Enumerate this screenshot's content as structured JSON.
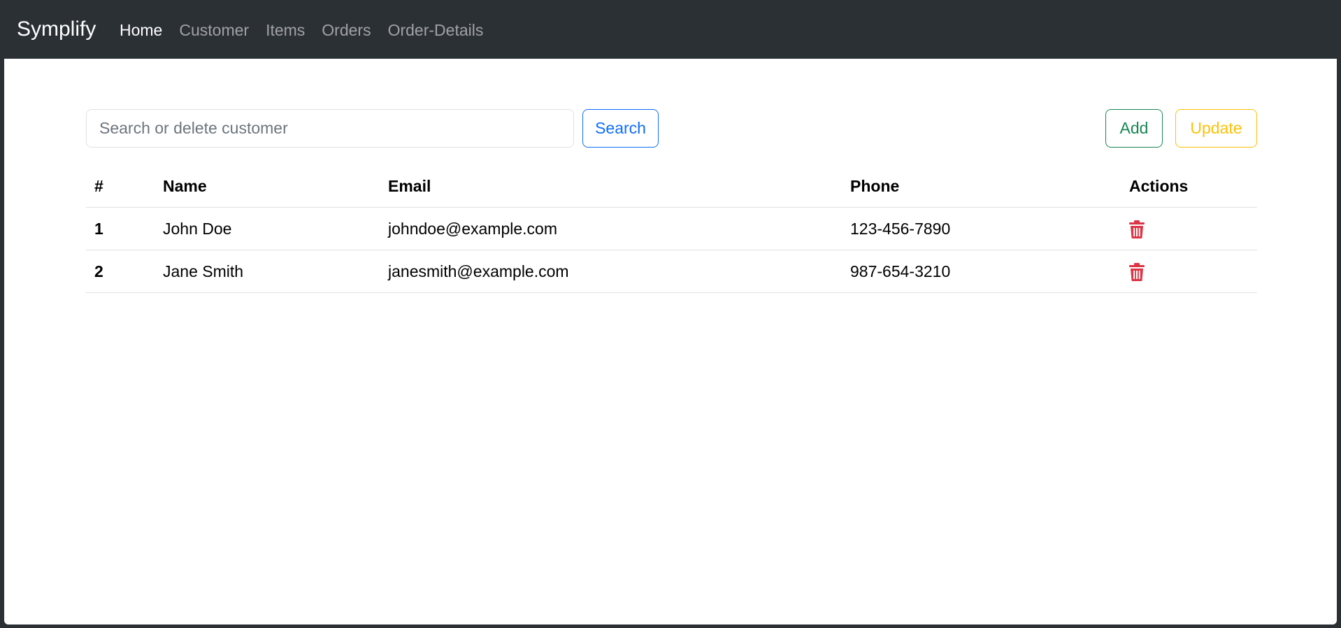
{
  "navbar": {
    "brand": "Symplify",
    "links": [
      {
        "label": "Home",
        "active": true
      },
      {
        "label": "Customer",
        "active": false
      },
      {
        "label": "Items",
        "active": false
      },
      {
        "label": "Orders",
        "active": false
      },
      {
        "label": "Order-Details",
        "active": false
      }
    ]
  },
  "search": {
    "placeholder": "Search or delete customer",
    "value": "",
    "button_label": "Search"
  },
  "actions": {
    "add_label": "Add",
    "update_label": "Update"
  },
  "table": {
    "headers": [
      "#",
      "Name",
      "Email",
      "Phone",
      "Actions"
    ],
    "rows": [
      {
        "num": "1",
        "name": "John Doe",
        "email": "johndoe@example.com",
        "phone": "123-456-7890",
        "action_icon": "trash-icon"
      },
      {
        "num": "2",
        "name": "Jane Smith",
        "email": "janesmith@example.com",
        "phone": "987-654-3210",
        "action_icon": "trash-icon"
      }
    ]
  },
  "colors": {
    "navbar_bg": "#2b3035",
    "primary": "#0d6efd",
    "success": "#198754",
    "warning": "#ffc107",
    "danger": "#dc3545"
  }
}
